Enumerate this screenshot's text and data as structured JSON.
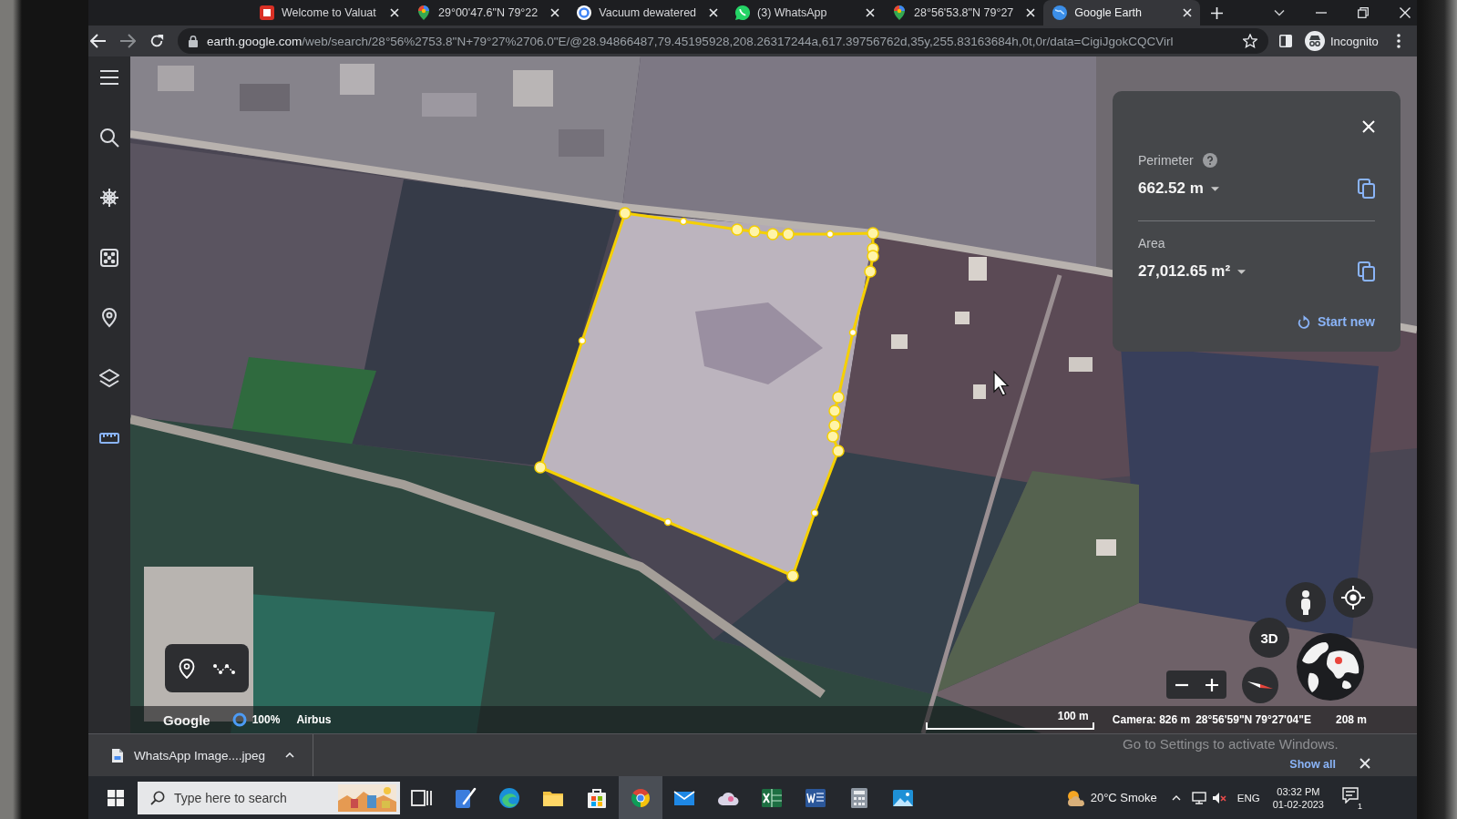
{
  "browser": {
    "tabs": [
      {
        "kind": "tile",
        "title": "Welcome to Valuat",
        "selected": false
      },
      {
        "kind": "pin",
        "title": "29°00'47.6\"N 79°22",
        "selected": false
      },
      {
        "kind": "ring",
        "title": "Vacuum dewatered",
        "selected": false
      },
      {
        "kind": "chat",
        "title": "(3) WhatsApp",
        "selected": false
      },
      {
        "kind": "pin",
        "title": "28°56'53.8\"N 79°27",
        "selected": false
      },
      {
        "kind": "globe",
        "title": "Google Earth",
        "selected": true
      }
    ],
    "forward_disabled": true,
    "url": {
      "host": "earth.google.com",
      "path": "/web/search/28°56%2753.8\"N+79°27%2706.0\"E/@28.94866487,79.45195928,208.26317244a,617.39756762d,35y,255.83163684h,0t,0r/data=CigiJgokCQCVirl"
    },
    "profile": "Incognito"
  },
  "earth": {
    "rail": [
      {
        "kind": "menu",
        "selected": false
      },
      {
        "kind": "search",
        "selected": false
      },
      {
        "kind": "wheel",
        "selected": false
      },
      {
        "kind": "dice",
        "selected": false
      },
      {
        "kind": "pin",
        "selected": false
      },
      {
        "kind": "layers",
        "selected": false
      },
      {
        "kind": "ruler",
        "selected": true
      }
    ],
    "measure": {
      "perimeter": {
        "label": "Perimeter",
        "value": "662.52 m"
      },
      "area": {
        "label": "Area",
        "value": "27,012.65 m²"
      },
      "action": "Start new"
    },
    "view_mode": "3D",
    "footer": {
      "logo": "Google",
      "progress": "100%",
      "credit": "Airbus",
      "scale": "100 m",
      "camera": "Camera: 826 m",
      "coords": "28°56'59\"N 79°27'04\"E",
      "elevation": "208 m"
    }
  },
  "downloads": {
    "file": "WhatsApp Image....jpeg",
    "show_all": "Show all"
  },
  "activation_notice": "Go to Settings to activate Windows.",
  "taskbar": {
    "search_placeholder": "Type here to search",
    "apps": [
      {
        "kind": "taskview",
        "active": false
      },
      {
        "kind": "pen",
        "active": false
      },
      {
        "kind": "swirl",
        "active": false
      },
      {
        "kind": "folder",
        "active": false
      },
      {
        "kind": "bag",
        "active": false
      },
      {
        "kind": "ring3",
        "active": true
      },
      {
        "kind": "envelope",
        "active": false
      },
      {
        "kind": "cloud",
        "active": false
      },
      {
        "kind": "sheet",
        "active": false
      },
      {
        "kind": "doc",
        "active": false
      },
      {
        "kind": "calc",
        "active": false
      },
      {
        "kind": "picture",
        "active": false
      }
    ],
    "weather": "20°C Smoke",
    "language": "ENG",
    "time": "03:32 PM",
    "date": "01-02-2023",
    "notification_count": "1"
  }
}
